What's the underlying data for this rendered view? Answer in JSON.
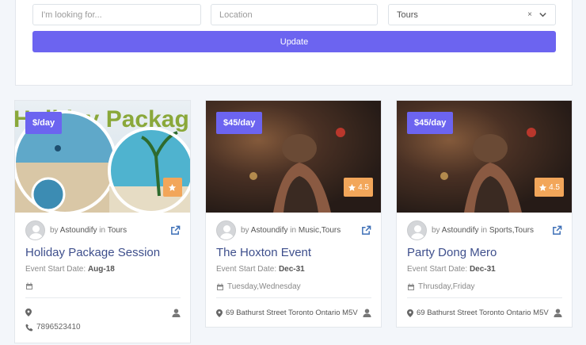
{
  "search": {
    "keyword_placeholder": "I'm looking for...",
    "location_placeholder": "Location",
    "category_value": "Tours",
    "clear_symbol": "×",
    "update_label": "Update"
  },
  "listings": [
    {
      "image_text": "Holiday Package",
      "price": "$/day",
      "rating": "",
      "by_prefix": "by",
      "author": "Astoundify",
      "in_prefix": "in",
      "categories": "Tours",
      "title": "Holiday Package Session",
      "start_label": "Event Start Date:",
      "start_date": "Aug-18",
      "days": "",
      "location": "",
      "phone": "7896523410"
    },
    {
      "price": "$45/day",
      "rating": "4.5",
      "by_prefix": "by",
      "author": "Astoundify",
      "in_prefix": "in",
      "categories": "Music,Tours",
      "title": "The Hoxton Event",
      "start_label": "Event Start Date:",
      "start_date": "Dec-31",
      "days": "Tuesday,Wednesday",
      "location": "69 Bathurst Street Toronto Ontario M5V"
    },
    {
      "price": "$45/day",
      "rating": "4.5",
      "by_prefix": "by",
      "author": "Astoundify",
      "in_prefix": "in",
      "categories": "Sports,Tours",
      "title": "Party Dong Mero",
      "start_label": "Event Start Date:",
      "start_date": "Dec-31",
      "days": "Thrusday,Friday",
      "location": "69 Bathurst Street Toronto Ontario M5V"
    }
  ],
  "colors": {
    "accent": "#6c64f0",
    "rating_badge": "#f2a65a",
    "title": "#3e4f8c",
    "page_background": "#f3f6fa"
  },
  "icons": [
    "star-icon",
    "external-link-icon",
    "calendar-icon",
    "map-marker-icon",
    "user-icon",
    "phone-icon",
    "chevron-down-icon"
  ]
}
